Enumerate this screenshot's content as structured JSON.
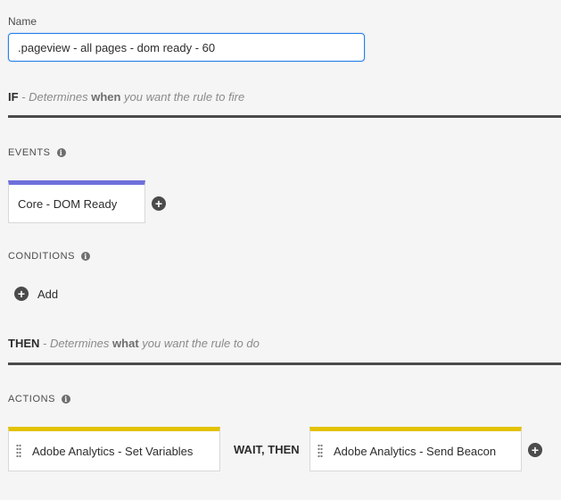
{
  "name_field": {
    "label": "Name",
    "value": ".pageview - all pages - dom ready - 60"
  },
  "if_section": {
    "keyword": "IF",
    "pre": " - Determines ",
    "emph": "when",
    "post": " you want the rule to fire"
  },
  "events": {
    "heading": "EVENTS",
    "info_icon": "info-icon",
    "items": [
      {
        "label": "Core - DOM Ready"
      }
    ],
    "add_icon": "plus-circle-icon"
  },
  "conditions": {
    "heading": "CONDITIONS",
    "info_icon": "info-icon",
    "add_label": "Add",
    "add_icon": "plus-circle-icon"
  },
  "then_section": {
    "keyword": "THEN",
    "pre": " - Determines ",
    "emph": "what",
    "post": " you want the rule to do"
  },
  "actions": {
    "heading": "ACTIONS",
    "info_icon": "info-icon",
    "items": [
      {
        "label": "Adobe Analytics - Set Variables"
      },
      {
        "label": "Adobe Analytics - Send Beacon"
      }
    ],
    "separator": "WAIT, THEN",
    "add_icon": "plus-circle-icon"
  },
  "colors": {
    "event_accent": "#6f6fdc",
    "action_accent": "#e3c200",
    "input_focus": "#2680eb"
  }
}
